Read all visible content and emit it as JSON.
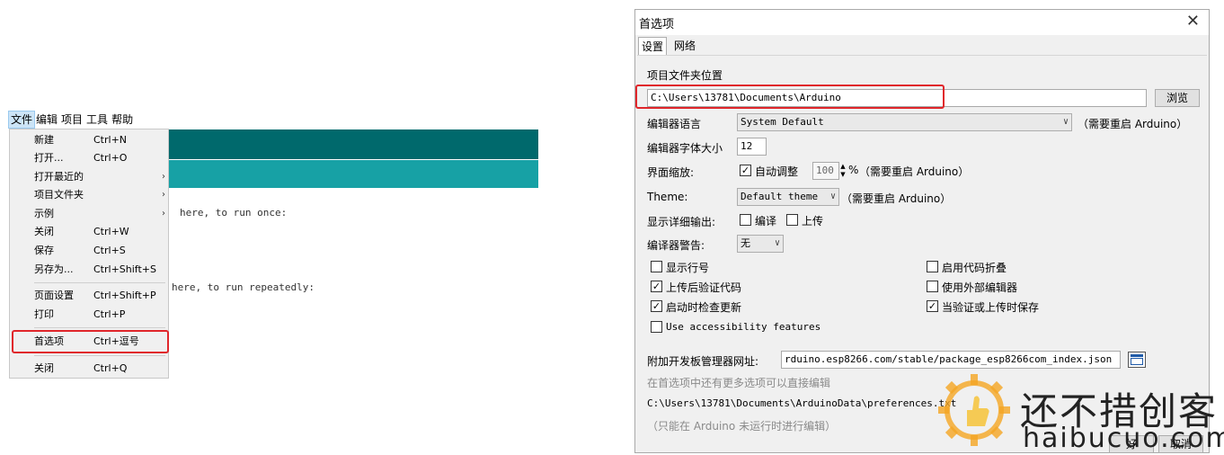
{
  "ide": {
    "menubar": [
      "文件",
      "编辑",
      "项目",
      "工具",
      "帮助"
    ],
    "code_line_1": "here, to run once:",
    "code_line_2": "here, to run repeatedly:",
    "file_menu": [
      {
        "label": "新建",
        "shortcut": "Ctrl+N"
      },
      {
        "label": "打开...",
        "shortcut": "Ctrl+O"
      },
      {
        "label": "打开最近的",
        "shortcut": ""
      },
      {
        "label": "项目文件夹",
        "shortcut": ""
      },
      {
        "label": "示例",
        "shortcut": ""
      },
      {
        "label": "关闭",
        "shortcut": "Ctrl+W"
      },
      {
        "label": "保存",
        "shortcut": "Ctrl+S"
      },
      {
        "label": "另存为...",
        "shortcut": "Ctrl+Shift+S"
      },
      {
        "label": "页面设置",
        "shortcut": "Ctrl+Shift+P"
      },
      {
        "label": "打印",
        "shortcut": "Ctrl+P"
      },
      {
        "label": "首选项",
        "shortcut": "Ctrl+逗号"
      },
      {
        "label": "关闭",
        "shortcut": "Ctrl+Q"
      }
    ],
    "submenu_arrow": "›"
  },
  "prefs": {
    "title": "首选项",
    "close_glyph": "✕",
    "tabs": [
      "设置",
      "网络"
    ],
    "sketchbook_label": "项目文件夹位置",
    "sketchbook_path": "C:\\Users\\13781\\Documents\\Arduino",
    "browse": "浏览",
    "editor_language_label": "编辑器语言",
    "editor_language_value": "System Default",
    "restart_note": "（需要重启 Arduino）",
    "font_size_label": "编辑器字体大小",
    "font_size_value": "12",
    "scale_label": "界面缩放:",
    "scale_auto": "自动调整",
    "scale_value": "100",
    "scale_unit": "%",
    "theme_label": "Theme:",
    "theme_value": "Default theme",
    "verbose_label": "显示详细输出:",
    "verbose_compile": "编译",
    "verbose_upload": "上传",
    "warnings_label": "编译器警告:",
    "warnings_value": "无",
    "options": [
      {
        "label": "显示行号",
        "checked": false
      },
      {
        "label": "启用代码折叠",
        "checked": false
      },
      {
        "label": "上传后验证代码",
        "checked": true
      },
      {
        "label": "使用外部编辑器",
        "checked": false
      },
      {
        "label": "启动时检查更新",
        "checked": true
      },
      {
        "label": "当验证或上传时保存",
        "checked": true
      },
      {
        "label": "Use accessibility features",
        "checked": false
      }
    ],
    "board_url_label": "附加开发板管理器网址:",
    "board_url_value": "rduino.esp8266.com/stable/package_esp8266com_index.json",
    "more_prefs_note": "在首选项中还有更多选项可以直接编辑",
    "prefs_file_path": "C:\\Users\\13781\\Documents\\ArduinoData\\preferences.txt",
    "edit_note": "（只能在 Arduino 未运行时进行编辑）",
    "ok": "好",
    "cancel": "取消"
  },
  "watermark": {
    "cn": "还不措创客",
    "en": "haibucuo.com"
  },
  "colors": {
    "teal_dark": "#00696c",
    "teal_light": "#17a1a5",
    "highlight_red": "#e0262b",
    "watermark_orange": "#f5a623"
  }
}
